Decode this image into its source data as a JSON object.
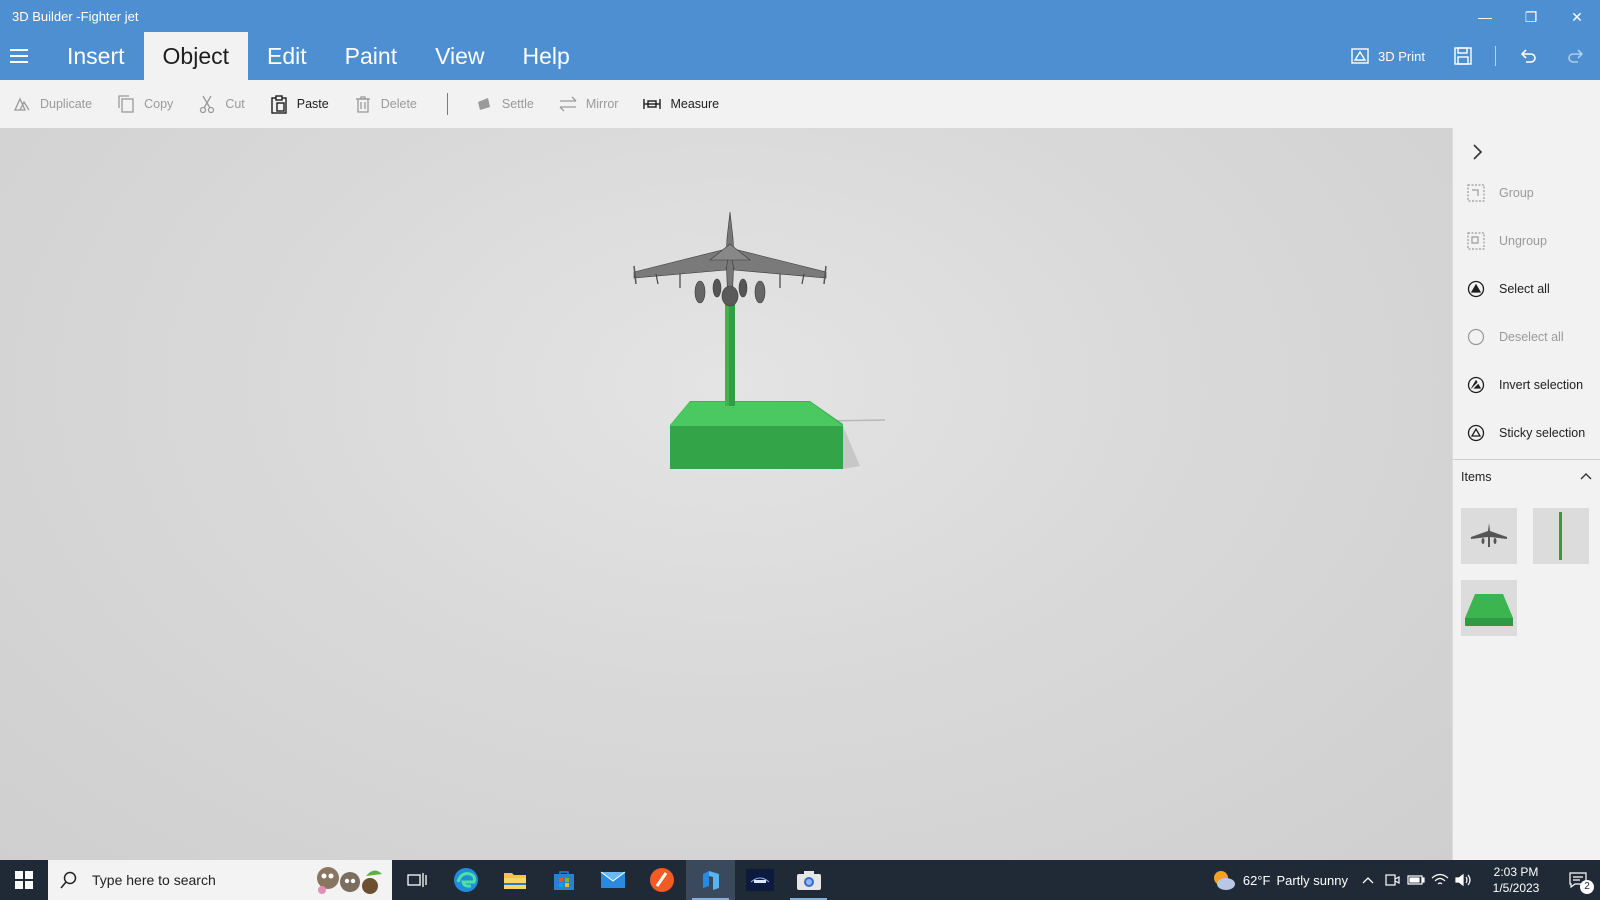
{
  "window": {
    "title": "3D Builder -Fighter jet",
    "minimize": "—",
    "restore": "❐",
    "close": "✕"
  },
  "tabs": [
    {
      "label": "Insert",
      "active": false
    },
    {
      "label": "Object",
      "active": true
    },
    {
      "label": "Edit",
      "active": false
    },
    {
      "label": "Paint",
      "active": false
    },
    {
      "label": "View",
      "active": false
    },
    {
      "label": "Help",
      "active": false
    }
  ],
  "top_right": {
    "print_label": "3D Print"
  },
  "ribbon": {
    "duplicate": "Duplicate",
    "copy": "Copy",
    "cut": "Cut",
    "paste": "Paste",
    "delete": "Delete",
    "settle": "Settle",
    "mirror": "Mirror",
    "measure": "Measure"
  },
  "panel": {
    "group": "Group",
    "ungroup": "Ungroup",
    "select_all": "Select all",
    "deselect_all": "Deselect all",
    "invert_selection": "Invert selection",
    "sticky_selection": "Sticky selection",
    "items_label": "Items"
  },
  "taskbar": {
    "search_placeholder": "Type here to search",
    "weather_temp": "62°F",
    "weather_desc": "Partly sunny",
    "time": "2:03 PM",
    "date": "1/5/2023",
    "notification_count": "2"
  },
  "colors": {
    "titlebar": "#4d8fd0",
    "ribbon": "#f2f2f2",
    "model_green": "#3cb550",
    "taskbar": "#1f2a36"
  }
}
